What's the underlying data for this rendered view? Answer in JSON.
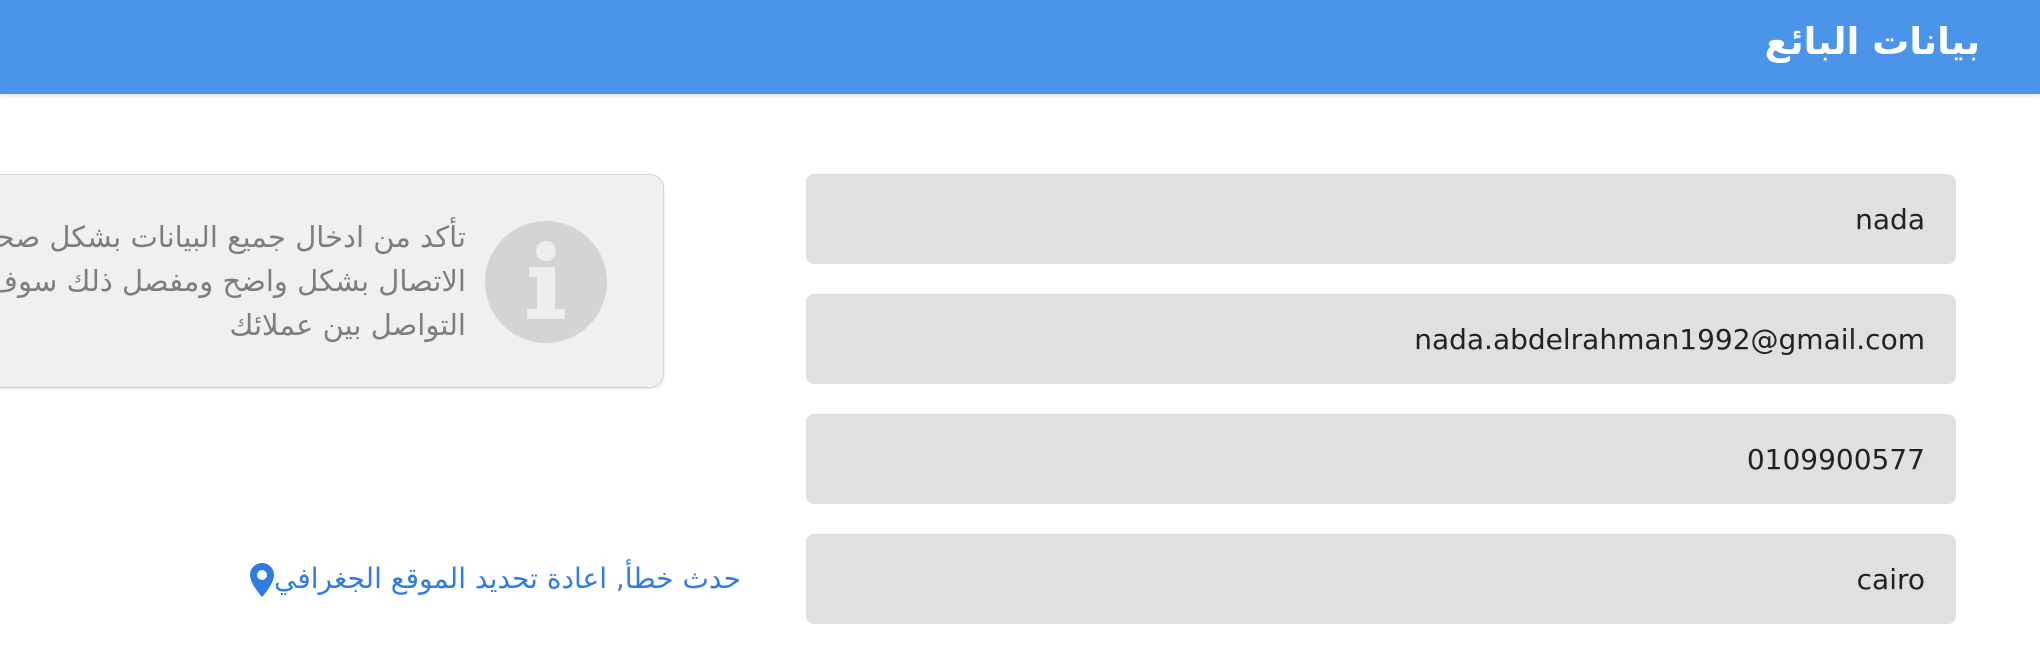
{
  "header": {
    "title": "بيانات البائع"
  },
  "form": {
    "name_value": "nada",
    "email_value": "nada.abdelrahman1992@gmail.com",
    "phone_value": "0109900577",
    "city_value": "cairo"
  },
  "info_box": {
    "text": "تأكد من ادخال جميع البيانات بشكل صحيح\nالاتصال بشكل واضح ومفصل ذلك سوف\nالتواصل بين عملائك",
    "icon": "info-icon"
  },
  "location": {
    "label": "حدث خطأ, اعادة تحديد الموقع الجغرافي",
    "icon": "map-pin-icon"
  },
  "colors": {
    "header_bg": "#4a95e9",
    "field_bg": "#e0e0e0",
    "info_bg": "#f0f0f0",
    "link": "#2f7de1"
  }
}
